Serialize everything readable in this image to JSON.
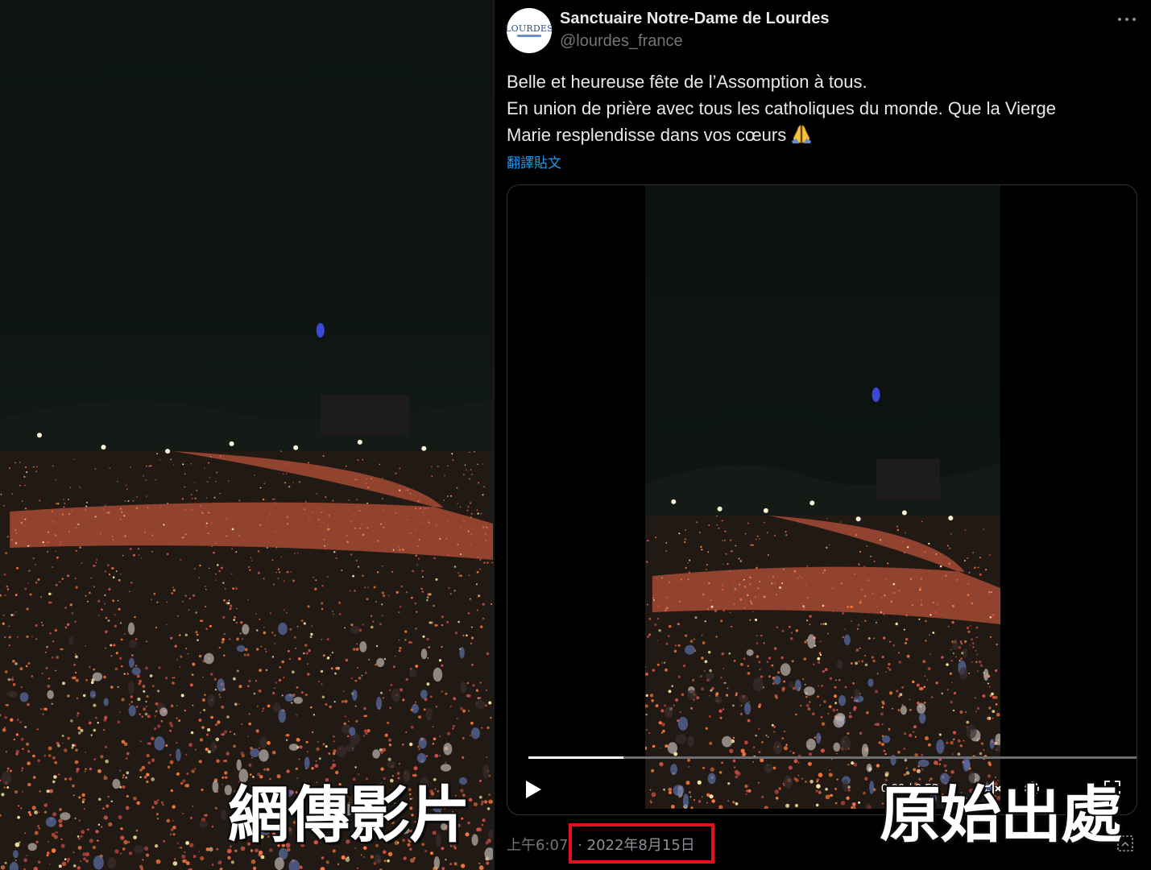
{
  "left_panel": {
    "caption": "網傳影片"
  },
  "tweet": {
    "avatar_logo": "LOURDES",
    "display_name": "Sanctuaire Notre-Dame de Lourdes",
    "handle": "@lourdes_france",
    "text_lines": [
      "Belle et heureuse fête de l’Assomption à tous.",
      "En union de prière avec tous les catholiques du monde. Que la Vierge",
      "Marie resplendisse dans vos cœurs"
    ],
    "emoji": "folded-hands-emoji",
    "translate_label": "翻譯貼文",
    "video": {
      "progress_fraction": 0.155,
      "time": "0:09 / 0:58"
    },
    "meta": {
      "time": "上午6:07",
      "separator": "·",
      "date": "2022年8月15日"
    },
    "icons": [
      "more-icon",
      "play-icon",
      "volume-icon",
      "settings-icon",
      "fullscreen-icon",
      "views-icon"
    ]
  },
  "right_caption": "原始出處",
  "colors": {
    "background": "#000000",
    "text": "#e7e9ea",
    "muted": "#71767b",
    "link": "#1d9bf0",
    "highlight_box": "#e0121b",
    "candle": "#ff7a3c"
  }
}
